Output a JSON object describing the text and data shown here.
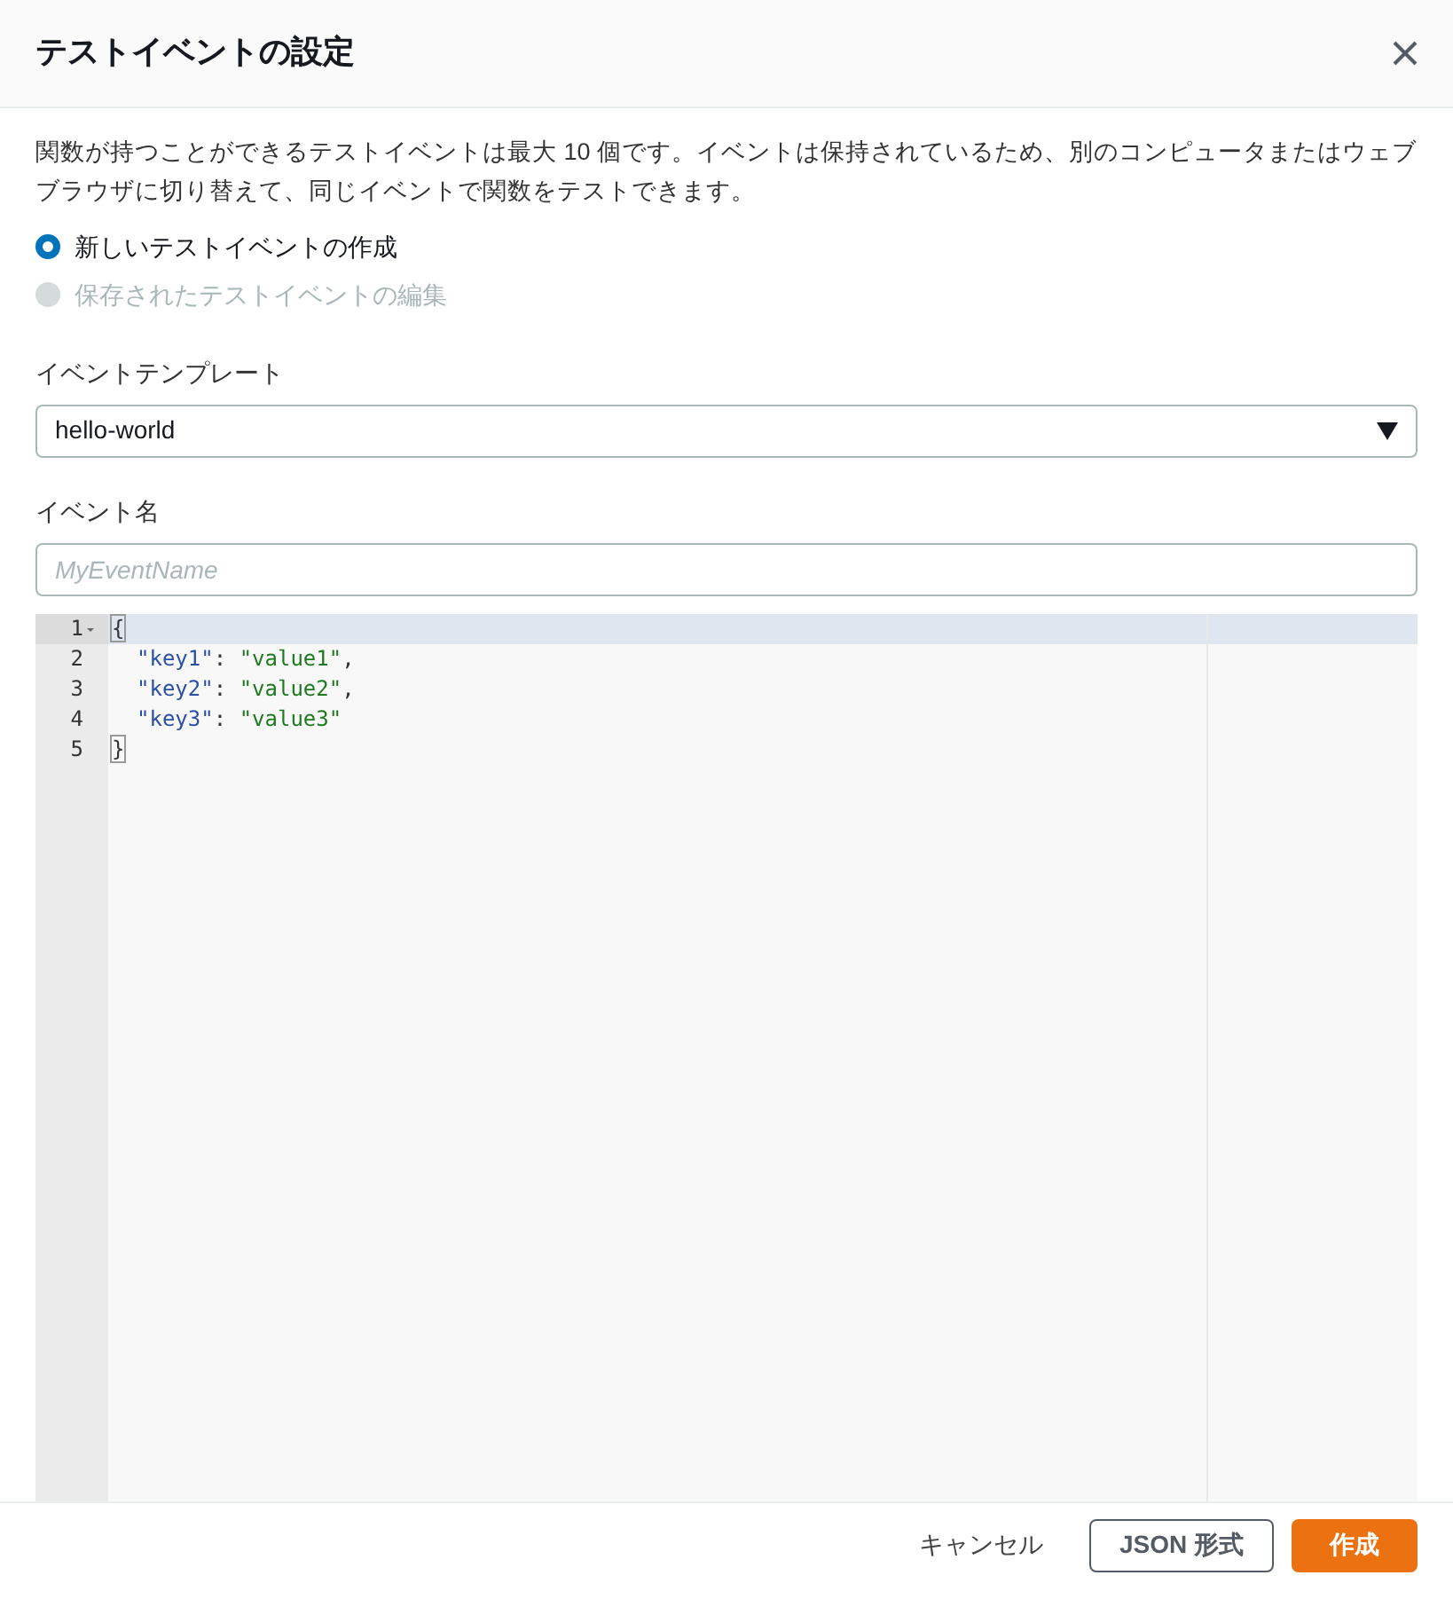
{
  "dialog": {
    "title": "テストイベントの設定",
    "description": "関数が持つことができるテストイベントは最大 10 個です。イベントは保持されているため、別のコンピュータまたはウェブブラウザに切り替えて、同じイベントで関数をテストできます。"
  },
  "options": [
    {
      "label": "新しいテストイベントの作成",
      "selected": true,
      "disabled": false
    },
    {
      "label": "保存されたテストイベントの編集",
      "selected": false,
      "disabled": true
    }
  ],
  "template": {
    "label": "イベントテンプレート",
    "value": "hello-world"
  },
  "event_name": {
    "label": "イベント名",
    "placeholder": "MyEventName"
  },
  "editor": {
    "lines": [
      {
        "number": "1",
        "active": true,
        "foldable": true,
        "indented": false,
        "tokens": [
          {
            "kind": "bracket",
            "text": "{"
          }
        ]
      },
      {
        "number": "2",
        "active": false,
        "foldable": false,
        "indented": true,
        "tokens": [
          {
            "kind": "key",
            "text": "\"key1\""
          },
          {
            "kind": "plain",
            "text": ": "
          },
          {
            "kind": "string",
            "text": "\"value1\""
          },
          {
            "kind": "plain",
            "text": ","
          }
        ]
      },
      {
        "number": "3",
        "active": false,
        "foldable": false,
        "indented": true,
        "tokens": [
          {
            "kind": "key",
            "text": "\"key2\""
          },
          {
            "kind": "plain",
            "text": ": "
          },
          {
            "kind": "string",
            "text": "\"value2\""
          },
          {
            "kind": "plain",
            "text": ","
          }
        ]
      },
      {
        "number": "4",
        "active": false,
        "foldable": false,
        "indented": true,
        "tokens": [
          {
            "kind": "key",
            "text": "\"key3\""
          },
          {
            "kind": "plain",
            "text": ": "
          },
          {
            "kind": "string",
            "text": "\"value3\""
          }
        ]
      },
      {
        "number": "5",
        "active": false,
        "foldable": false,
        "indented": false,
        "tokens": [
          {
            "kind": "bracket",
            "text": "}"
          }
        ]
      }
    ]
  },
  "buttons": [
    {
      "label": "キャンセル",
      "kind": "link"
    },
    {
      "label": "JSON 形式",
      "kind": "secondary"
    },
    {
      "label": "作成",
      "kind": "primary"
    }
  ]
}
